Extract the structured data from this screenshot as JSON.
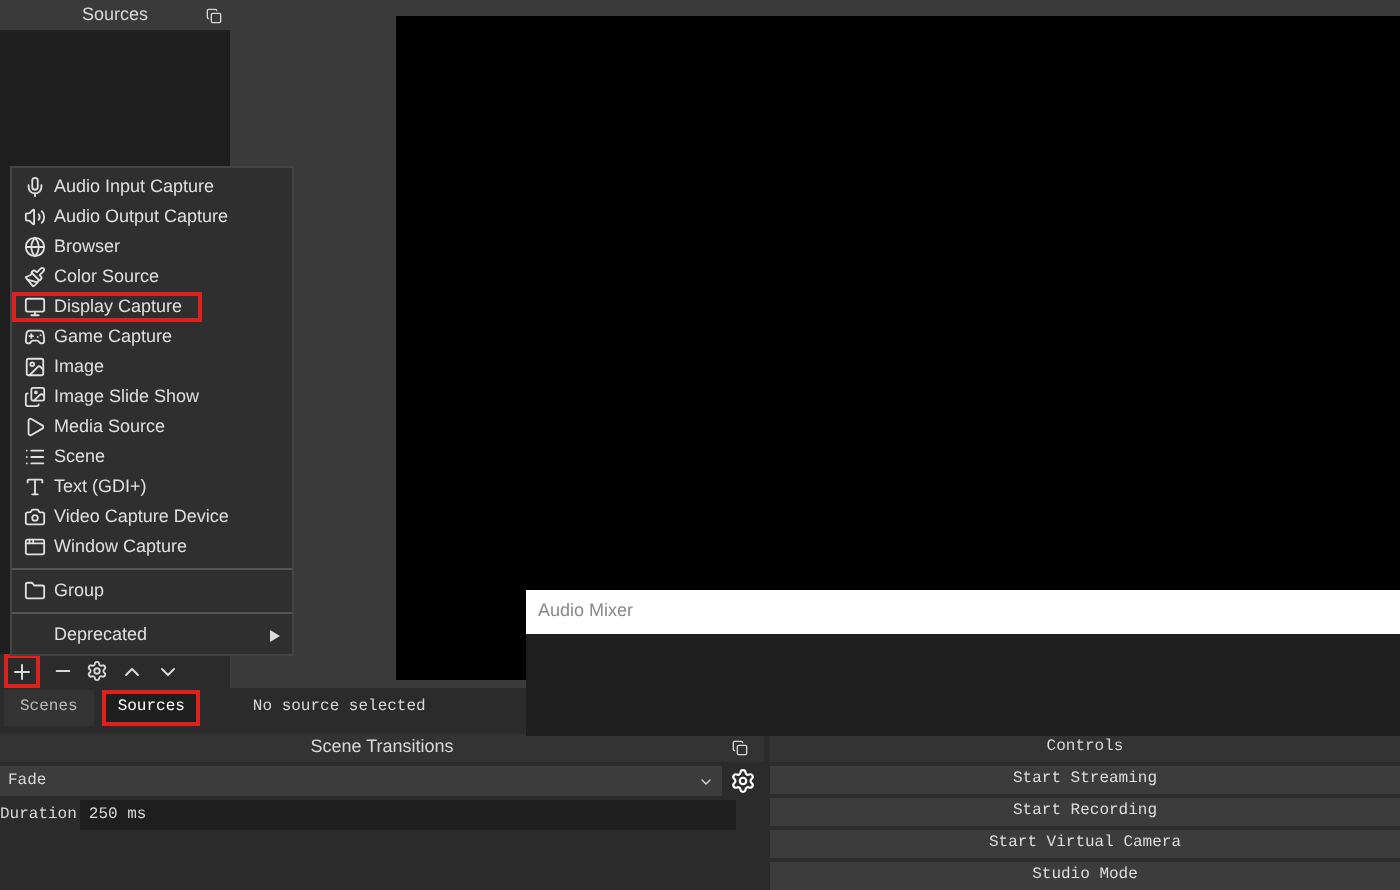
{
  "sources_dock": {
    "title": "Sources"
  },
  "add_menu": {
    "groups": [
      [
        {
          "label": "Audio Input Capture",
          "highlighted": false
        },
        {
          "label": "Audio Output Capture",
          "highlighted": false
        },
        {
          "label": "Browser",
          "highlighted": false
        },
        {
          "label": "Color Source",
          "highlighted": false
        },
        {
          "label": "Display Capture",
          "highlighted": true
        },
        {
          "label": "Game Capture",
          "highlighted": false
        },
        {
          "label": "Image",
          "highlighted": false
        },
        {
          "label": "Image Slide Show",
          "highlighted": false
        },
        {
          "label": "Media Source",
          "highlighted": false
        },
        {
          "label": "Scene",
          "highlighted": false
        },
        {
          "label": "Text (GDI+)",
          "highlighted": false
        },
        {
          "label": "Video Capture Device",
          "highlighted": false
        },
        {
          "label": "Window Capture",
          "highlighted": false
        }
      ],
      [
        {
          "label": "Group",
          "highlighted": false
        }
      ],
      [
        {
          "label": "Deprecated",
          "highlighted": false,
          "submenu": true
        }
      ]
    ]
  },
  "toolbar": {
    "add_highlighted": true
  },
  "dock_tabs": [
    {
      "label": "Scenes",
      "selected": false,
      "highlighted": false
    },
    {
      "label": "Sources",
      "selected": true,
      "highlighted": true
    }
  ],
  "properties_bar": {
    "text": "No source selected"
  },
  "audio_mixer": {
    "title": "Audio Mixer"
  },
  "scene_transitions": {
    "title": "Scene Transitions",
    "transition": "Fade",
    "duration_label": "Duration",
    "duration": "250 ms"
  },
  "controls": {
    "title": "Controls",
    "buttons": [
      "Start Streaming",
      "Start Recording",
      "Start Virtual Camera",
      "Studio Mode"
    ]
  }
}
